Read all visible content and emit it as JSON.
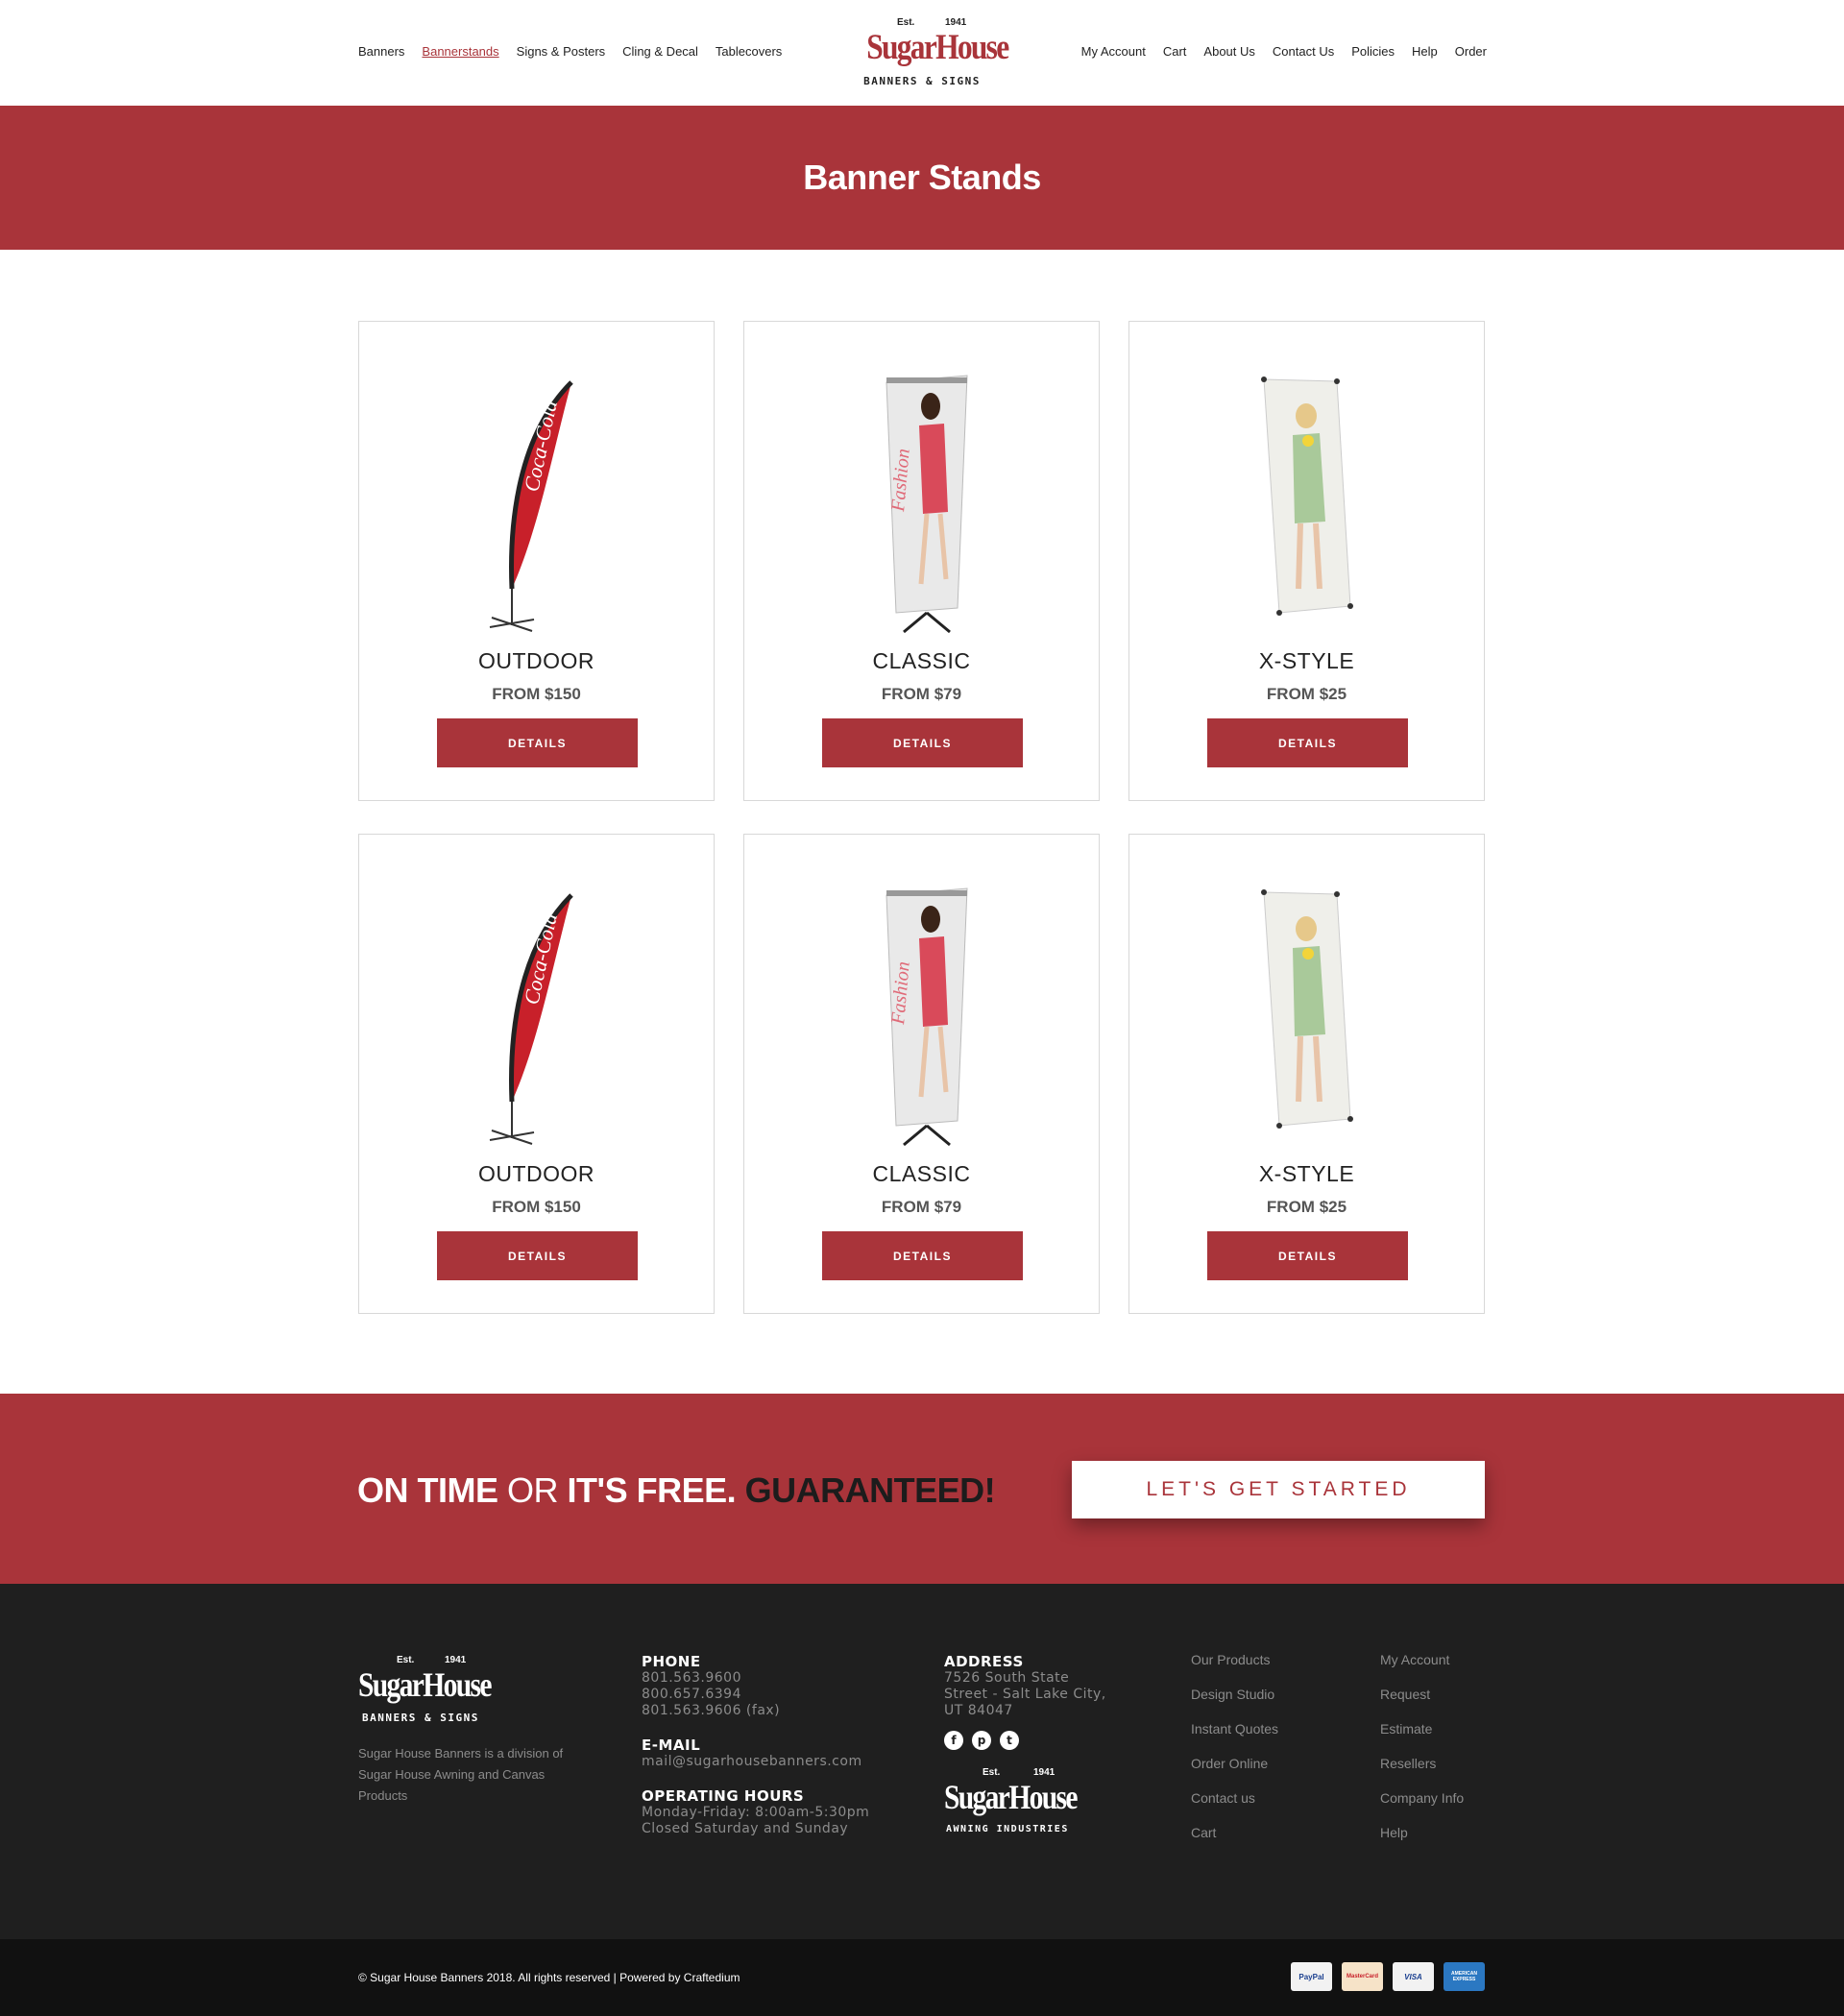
{
  "nav": {
    "left": [
      {
        "label": "Banners",
        "active": false
      },
      {
        "label": "Bannerstands",
        "active": true
      },
      {
        "label": "Signs & Posters",
        "active": false
      },
      {
        "label": "Cling & Decal",
        "active": false
      },
      {
        "label": "Tablecovers",
        "active": false
      }
    ],
    "right": [
      {
        "label": "My Account"
      },
      {
        "label": "Cart"
      },
      {
        "label": "About Us"
      },
      {
        "label": "Contact Us"
      },
      {
        "label": "Policies"
      },
      {
        "label": "Help"
      },
      {
        "label": "Order"
      }
    ]
  },
  "logo": {
    "est": "Est.",
    "year": "1941",
    "name": "SugarHouse",
    "tagline": "BANNERS & SIGNS"
  },
  "hero": {
    "title": "Banner Stands"
  },
  "products": [
    {
      "title": "OUTDOOR",
      "price": "FROM $150",
      "button": "DETAILS",
      "image": "feather-flag"
    },
    {
      "title": "CLASSIC",
      "price": "FROM $79",
      "button": "DETAILS",
      "image": "rollup-banner"
    },
    {
      "title": "X-STYLE",
      "price": "FROM $25",
      "button": "DETAILS",
      "image": "x-banner"
    },
    {
      "title": "OUTDOOR",
      "price": "FROM $150",
      "button": "DETAILS",
      "image": "feather-flag"
    },
    {
      "title": "CLASSIC",
      "price": "FROM $79",
      "button": "DETAILS",
      "image": "rollup-banner"
    },
    {
      "title": "X-STYLE",
      "price": "FROM $25",
      "button": "DETAILS",
      "image": "x-banner"
    }
  ],
  "band": {
    "part1": "ON TIME",
    "part2": "OR",
    "part3": "IT'S FREE.",
    "part4": "GUARANTEED!",
    "cta": "LET'S GET STARTED"
  },
  "footer": {
    "about": "Sugar House Banners is a division of Sugar House Awning and Canvas Products",
    "phone_heading": "PHONE",
    "phones": [
      "801.563.9600",
      "800.657.6394",
      "801.563.9606 (fax)"
    ],
    "email_heading": "E-MAIL",
    "email": "mail@sugarhousebanners.com",
    "hours_heading": "OPERATING HOURS",
    "hours": [
      "Monday-Friday: 8:00am-5:30pm",
      "Closed Saturday and Sunday"
    ],
    "address_heading": "ADDRESS",
    "address": [
      "7526 South State",
      "Street - Salt Lake City,",
      "UT 84047"
    ],
    "social": [
      "facebook-icon",
      "pinterest-icon",
      "twitter-icon"
    ],
    "awning_logo": {
      "est": "Est.",
      "year": "1941",
      "name": "SugarHouse",
      "tagline": "AWNING INDUSTRIES"
    },
    "links_col1": [
      "Our Products",
      "Design Studio",
      "Instant Quotes",
      "Order Online",
      "Contact us",
      "Cart"
    ],
    "links_col2": [
      "My Account",
      "Request",
      "Estimate",
      "Resellers",
      "Company Info",
      "Help"
    ],
    "copyright": "© Sugar House Banners 2018. All rights reserved   |   Powered by Craftedium",
    "payments": [
      "PayPal",
      "MasterCard",
      "VISA",
      "AMERICAN EXPRESS"
    ]
  },
  "colors": {
    "brand_red": "#a9343a",
    "footer_bg": "#1f1f1f",
    "bottom_bg": "#111111"
  }
}
